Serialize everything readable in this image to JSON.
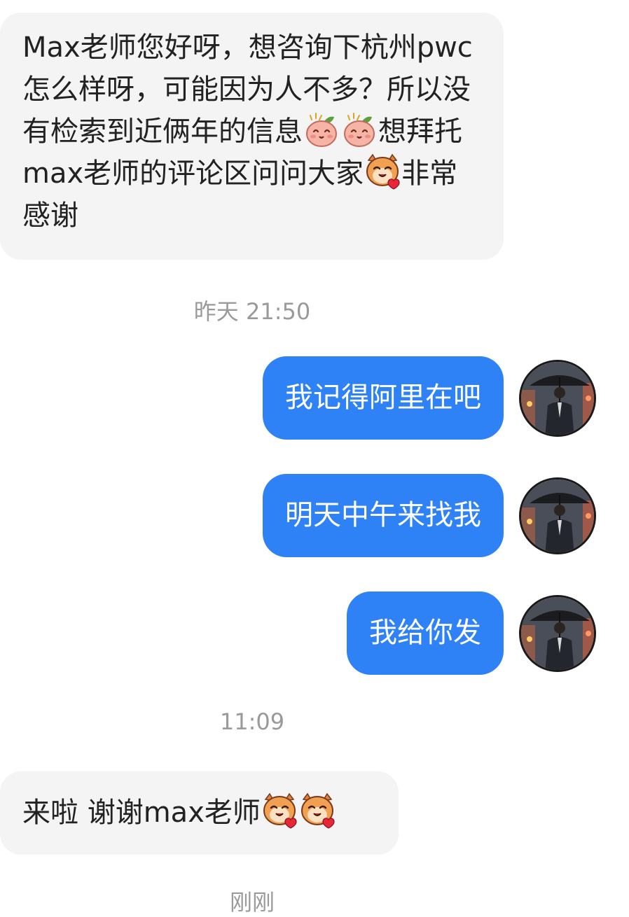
{
  "colors": {
    "incoming_bubble": "#f4f4f4",
    "outgoing_bubble": "#2f82f6",
    "timestamp": "#9a9a9a"
  },
  "messages": {
    "m1": {
      "part1": "Max老师您好呀，想咨询下杭州pwc怎么样呀，可能因为人不多？所以没有检索到近俩年的信息",
      "emoji1": "peach-blush-emoji",
      "emoji2": "peach-blush-emoji",
      "part2": "想拜托max老师的评论区问问大家",
      "emoji3": "cat-heart-emoji",
      "part3": "非常感谢"
    },
    "ts1": "昨天 21:50",
    "m2": "我记得阿里在吧",
    "m3": "明天中午来找我",
    "m4": "我给你发",
    "ts2": "11:09",
    "m5": {
      "text": "来啦 谢谢max老师",
      "emoji1": "cat-heart-emoji",
      "emoji2": "cat-heart-emoji"
    },
    "ts3": "刚刚"
  },
  "avatar": {
    "icon": "man-with-umbrella-avatar"
  }
}
